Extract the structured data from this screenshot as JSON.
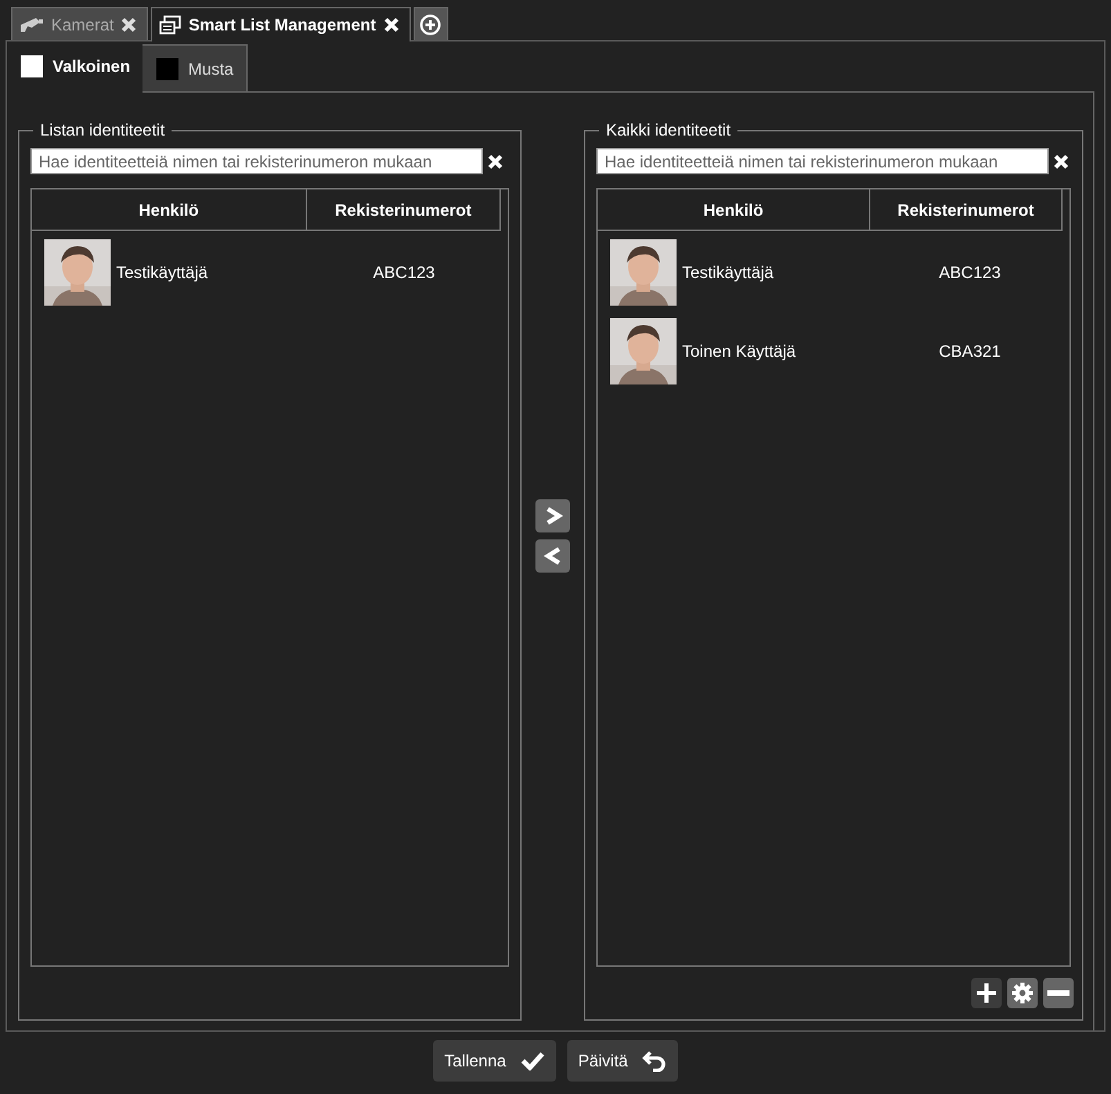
{
  "top_tabs": [
    {
      "label": "Kamerat",
      "kind": "camera",
      "selected": false
    },
    {
      "label": "Smart List Management",
      "kind": "list",
      "selected": true
    }
  ],
  "lists": [
    {
      "label": "Valkoinen",
      "color": "#ffffff",
      "selected": true
    },
    {
      "label": "Musta",
      "color": "#000000",
      "selected": false
    }
  ],
  "panels": [
    {
      "title": "Listan identiteetit",
      "search": {
        "placeholder": "Hae identiteetteiä nimen tai rekisterinumeron mukaan"
      },
      "columns": [
        "Henkilö",
        "Rekisterinumerot"
      ],
      "rows": [
        {
          "name": "Testikäyttäjä",
          "plate": "ABC123"
        }
      ],
      "tools": false
    },
    {
      "title": "Kaikki identiteetit",
      "search": {
        "placeholder": "Hae identiteetteiä nimen tai rekisterinumeron mukaan"
      },
      "columns": [
        "Henkilö",
        "Rekisterinumerot"
      ],
      "rows": [
        {
          "name": "Testikäyttäjä",
          "plate": "ABC123"
        },
        {
          "name": "Toinen Käyttäjä",
          "plate": "CBA321"
        }
      ],
      "tools": true
    }
  ],
  "footer_buttons": [
    {
      "label": "Tallenna",
      "kind": "save"
    },
    {
      "label": "Päivitä",
      "kind": "refresh"
    }
  ]
}
